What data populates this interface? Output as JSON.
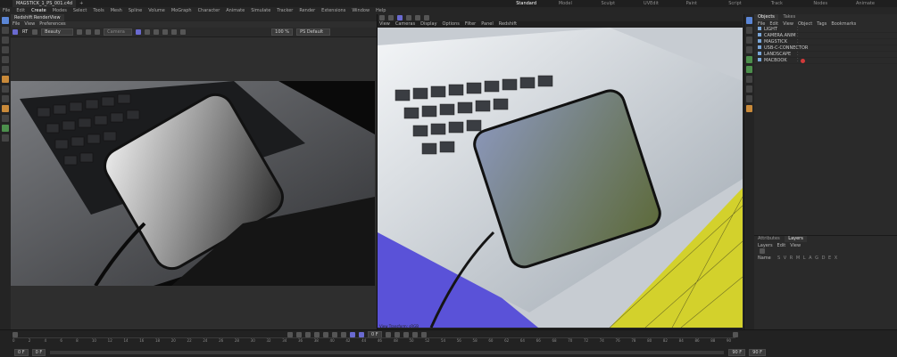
{
  "app": {
    "tab_title": "MAGSTICK_1_PS_001.c4d",
    "layouts": [
      "Standard",
      "Model",
      "Sculpt",
      "UVEdit",
      "Paint",
      "Script",
      "Track",
      "Nodes",
      "Animate"
    ],
    "active_layout": "Standard"
  },
  "menu": [
    "File",
    "Edit",
    "Create",
    "Modes",
    "Select",
    "Tools",
    "Mesh",
    "Spline",
    "Volume",
    "MoGraph",
    "Character",
    "Animate",
    "Simulate",
    "Tracker",
    "Render",
    "Extensions",
    "Window",
    "Help"
  ],
  "picture_viewer": {
    "title": "Redshift RenderView",
    "menu": [
      "File",
      "View",
      "Preferences"
    ],
    "mode": "RT",
    "beauty": "Beauty",
    "zoom": "100 %",
    "camera": "Camera",
    "option": "PS Default"
  },
  "viewport": {
    "menu": [
      "View",
      "Cameras",
      "Display",
      "Options",
      "Filter",
      "Panel",
      "Redshift"
    ],
    "footer": "View  Transform: sRGB"
  },
  "objects": {
    "tabs": [
      "Objects",
      "Takes"
    ],
    "menu": [
      "File",
      "Edit",
      "View",
      "Object",
      "Tags",
      "Bookmarks"
    ],
    "items": [
      "LIGHT",
      "CAMERA.ANIM",
      "MAGSTICK",
      "USB-C-CONNECTOR",
      "LANDSCAPE",
      "MACBOOK"
    ]
  },
  "attributes": {
    "tabs": [
      "Attributes",
      "Layers"
    ],
    "menu": [
      "Layers",
      "Edit",
      "View"
    ],
    "header": "Name",
    "columns": "S V R M L A G D E X"
  },
  "timeline": {
    "ticks": [
      "0",
      "2",
      "4",
      "6",
      "8",
      "10",
      "12",
      "14",
      "16",
      "18",
      "20",
      "22",
      "24",
      "26",
      "28",
      "30",
      "32",
      "34",
      "36",
      "38",
      "40",
      "42",
      "44",
      "46",
      "48",
      "50",
      "52",
      "54",
      "56",
      "58",
      "60",
      "62",
      "64",
      "66",
      "68",
      "70",
      "72",
      "74",
      "76",
      "78",
      "80",
      "82",
      "84",
      "86",
      "88",
      "90"
    ],
    "start": "0 F",
    "current": "0 F",
    "end": "90 F",
    "end2": "90 F"
  },
  "colors": {
    "accent": "#6a6ad0",
    "viewport_yellow": "#d3d12c",
    "viewport_blue": "#5a52d8",
    "tag_red": "#d23a3a"
  }
}
